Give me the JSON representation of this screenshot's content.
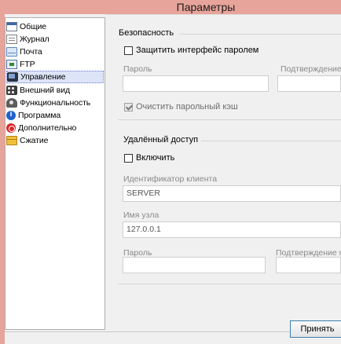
{
  "window": {
    "title": "Параметры"
  },
  "sidebar": {
    "items": [
      {
        "label": "Общие",
        "icon": "general-icon"
      },
      {
        "label": "Журнал",
        "icon": "journal-icon"
      },
      {
        "label": "Почта",
        "icon": "mail-icon"
      },
      {
        "label": "FTP",
        "icon": "ftp-icon"
      },
      {
        "label": "Управление",
        "icon": "management-icon",
        "selected": true
      },
      {
        "label": "Внешний вид",
        "icon": "appearance-icon"
      },
      {
        "label": "Функциональность",
        "icon": "functionality-icon"
      },
      {
        "label": "Программа",
        "icon": "program-info-icon"
      },
      {
        "label": "Дополнительно",
        "icon": "advanced-icon"
      },
      {
        "label": "Сжатие",
        "icon": "compression-icon"
      }
    ]
  },
  "security": {
    "title": "Безопасность",
    "protect_label": "Защитить интерфейс паролем",
    "protect_checked": false,
    "password_label": "Пароль",
    "password_value": "",
    "confirm_label": "Подтверждение п",
    "confirm_value": "",
    "clear_cache_label": "Очистить парольный кэш",
    "clear_cache_checked": true
  },
  "remote": {
    "title": "Удалённый доступ",
    "enable_label": "Включить",
    "enable_checked": false,
    "client_id_label": "Идентификатор клиента",
    "client_id_value": "SERVER",
    "host_label": "Имя узла",
    "host_value": "127.0.0.1",
    "password_label": "Пароль",
    "password_value": "",
    "confirm_label": "Подтверждение па",
    "confirm_value": ""
  },
  "buttons": {
    "apply": "Принять"
  },
  "colors": {
    "titlebar": "#e7a49a",
    "selection": "#dde4f7",
    "button_border": "#3c7fb1"
  }
}
